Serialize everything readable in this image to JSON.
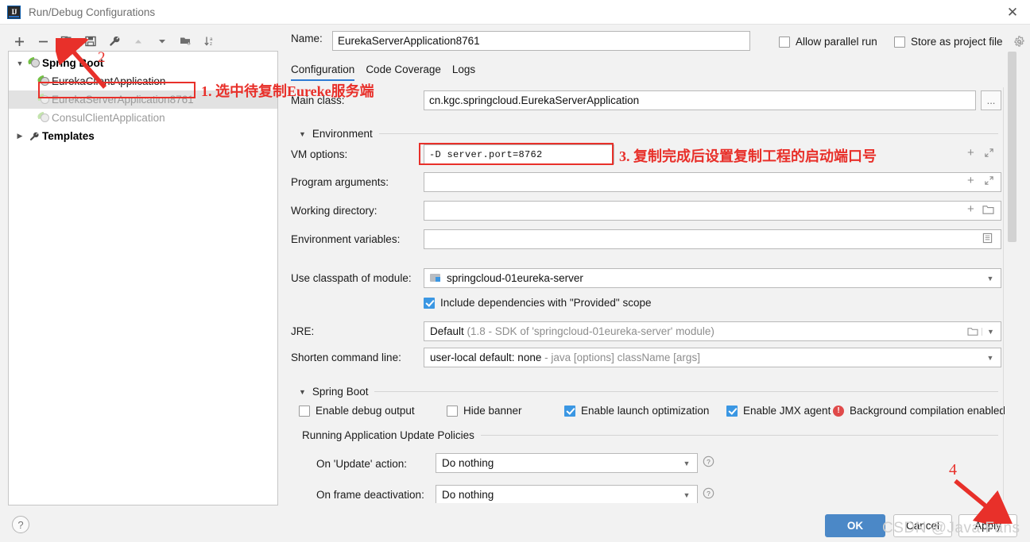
{
  "window": {
    "title": "Run/Debug Configurations",
    "logo_text": "IJ",
    "close_label": "✕"
  },
  "toolbar": {
    "items": [
      {
        "name": "add-configuration",
        "label": "+"
      },
      {
        "name": "remove-configuration",
        "label": "−"
      },
      {
        "name": "copy-configuration",
        "label": "copy"
      },
      {
        "name": "save-configuration",
        "label": "save"
      },
      {
        "name": "edit-templates",
        "label": "wrench"
      },
      {
        "name": "move-up",
        "label": "up"
      },
      {
        "name": "move-down",
        "label": "down"
      },
      {
        "name": "new-folder",
        "label": "folder-plus"
      },
      {
        "name": "sort-alphabetically",
        "label": "sort-az"
      }
    ]
  },
  "tree": {
    "groups": [
      {
        "label": "Spring Boot",
        "expanded": true,
        "children": [
          {
            "label": "EurekaClientApplication",
            "dim": false,
            "selected": false
          },
          {
            "label": "EurekaServerApplication8761",
            "dim": true,
            "selected": true
          },
          {
            "label": "ConsulClientApplication",
            "dim": true,
            "selected": false
          }
        ]
      }
    ],
    "templates_label": "Templates"
  },
  "header": {
    "name_label": "Name:",
    "name_value": "EurekaServerApplication8761",
    "allow_parallel_run": "Allow parallel run",
    "store_as_project_file": "Store as project file"
  },
  "tabs": [
    {
      "label": "Configuration",
      "active": true
    },
    {
      "label": "Code Coverage",
      "active": false
    },
    {
      "label": "Logs",
      "active": false
    }
  ],
  "form": {
    "main_class_label": "Main class:",
    "main_class_value": "cn.kgc.springcloud.EurekaServerApplication",
    "main_class_browse": "...",
    "environment_section": "Environment",
    "vm_options_label": "VM options:",
    "vm_options_value": "-D server.port=8762",
    "program_arguments_label": "Program arguments:",
    "program_arguments_value": "",
    "working_directory_label": "Working directory:",
    "working_directory_value": "",
    "environment_variables_label": "Environment variables:",
    "environment_variables_value": "",
    "use_classpath_label": "Use classpath of module:",
    "use_classpath_value": "springcloud-01eureka-server",
    "include_dependencies_label": "Include dependencies with \"Provided\" scope",
    "jre_label": "JRE:",
    "jre_value": "Default",
    "jre_value_muted": "(1.8 - SDK of 'springcloud-01eureka-server' module)",
    "shorten_label": "Shorten command line:",
    "shorten_value": "user-local default: none",
    "shorten_value_muted": "- java [options] className [args]",
    "spring_boot_section": "Spring Boot",
    "enable_debug_output": "Enable debug output",
    "hide_banner": "Hide banner",
    "enable_launch_optimization": "Enable launch optimization",
    "enable_jmx_agent": "Enable JMX agent",
    "background_compilation": "Background compilation enabled",
    "running_policies_section": "Running Application Update Policies",
    "on_update_label": "On 'Update' action:",
    "on_update_value": "Do nothing",
    "on_frame_deactivation_label": "On frame deactivation:",
    "on_frame_deactivation_value": "Do nothing",
    "help_hint": "?"
  },
  "footer": {
    "ok": "OK",
    "cancel": "Cancel",
    "apply": "Apply",
    "help": "?"
  },
  "annotations": {
    "step1": "1. 选中待复制Eureke服务端",
    "step2": "2",
    "step3": "3. 复制完成后设置复制工程的启动端口号",
    "step4": "4",
    "watermark": "CSDN @Java Fans"
  },
  "colors": {
    "accent": "#4b88c7",
    "annotation": "#e8302a",
    "checkbox_on": "#3b97e3",
    "tab_underline": "#2d7bd4"
  }
}
